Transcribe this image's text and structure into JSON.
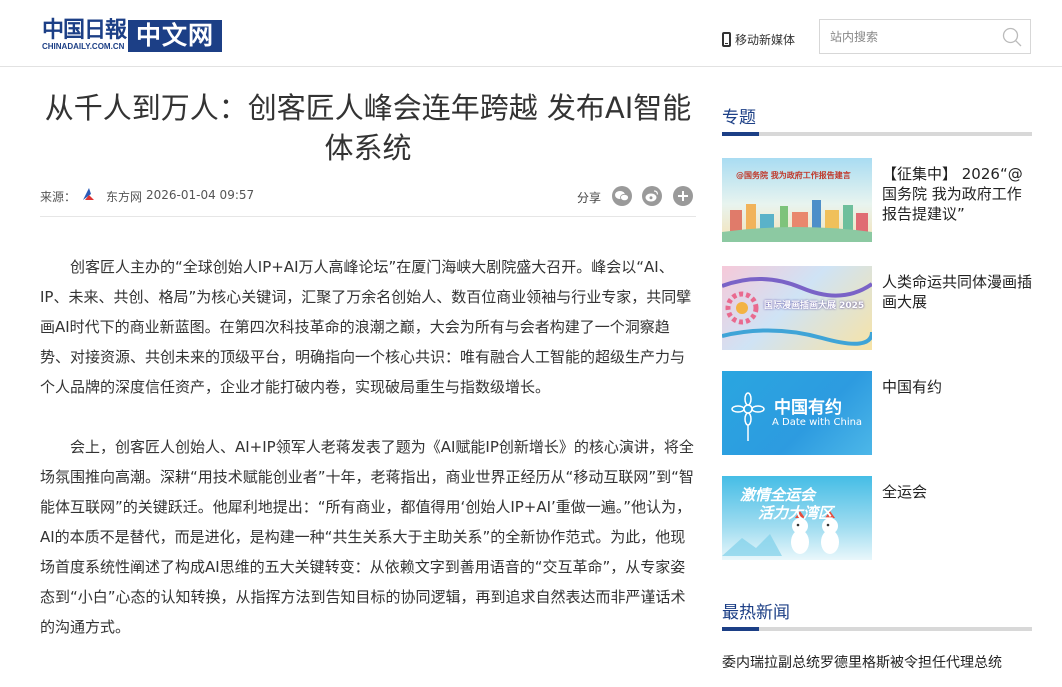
{
  "header": {
    "logo_cd": "中国日報",
    "logo_sub": "CHINADAILY.COM.CN",
    "logo_box": "中文网",
    "mobile_label": "移动新媒体",
    "search_placeholder": "站内搜索"
  },
  "article": {
    "title": "从千人到万人：创客匠人峰会连年跨越 发布AI智能体系统",
    "source_label": "来源：",
    "source_name": "东方网",
    "datetime": "2026-01-04 09:57",
    "share_label": "分享",
    "paragraphs": [
      "创客匠人主办的“全球创始人IP+AI万人高峰论坛”在厦门海峡大剧院盛大召开。峰会以“AI、IP、未来、共创、格局”为核心关键词，汇聚了万余名创始人、数百位商业领袖与行业专家，共同擘画AI时代下的商业新蓝图。在第四次科技革命的浪潮之巅，大会为所有与会者构建了一个洞察趋势、对接资源、共创未来的顶级平台，明确指向一个核心共识：唯有融合人工智能的超级生产力与个人品牌的深度信任资产，企业才能打破内卷，实现破局重生与指数级增长。",
      "会上，创客匠人创始人、AI+IP领军人老蒋发表了题为《AI赋能IP创新增长》的核心演讲，将全场氛围推向高潮。深耕“用技术赋能创业者”十年，老蒋指出，商业世界正经历从“移动互联网”到“智能体互联网”的关键跃迁。他犀利地提出：“所有商业，都值得用‘创始人IP+AI’重做一遍。”他认为，AI的本质不是替代，而是进化，是构建一种“共生关系大于主助关系”的全新协作范式。为此，他现场首度系统性阐述了构成AI思维的五大关键转变：从依赖文字到善用语音的“交互革命”，从专家姿态到“小白”心态的认知转换，从指挥方法到告知目标的协同逻辑，再到追求自然表达而非严谨话术的沟通方式。"
    ]
  },
  "sidebar": {
    "topics_title": "专题",
    "topics": [
      {
        "title": "【征集中】 2026“@国务院 我为政府工作报告提建议”",
        "thumb_text": "@国务院 我为政府工作报告建言"
      },
      {
        "title": "人类命运共同体漫画插画大展",
        "thumb_text": "国际漫画插画大展 2025"
      },
      {
        "title": "中国有约",
        "thumb_text": "中国有约",
        "thumb_sub": "A Date with China"
      },
      {
        "title": "全运会",
        "thumb_text": "激情全运会",
        "thumb_sub": "活力大湾区"
      }
    ],
    "hot_title": "最热新闻",
    "hot_items": [
      "委内瑞拉副总统罗德里格斯被令担任代理总统"
    ]
  },
  "colors": {
    "brand_blue": "#1c3f86",
    "divider": "#e6e6e6"
  }
}
